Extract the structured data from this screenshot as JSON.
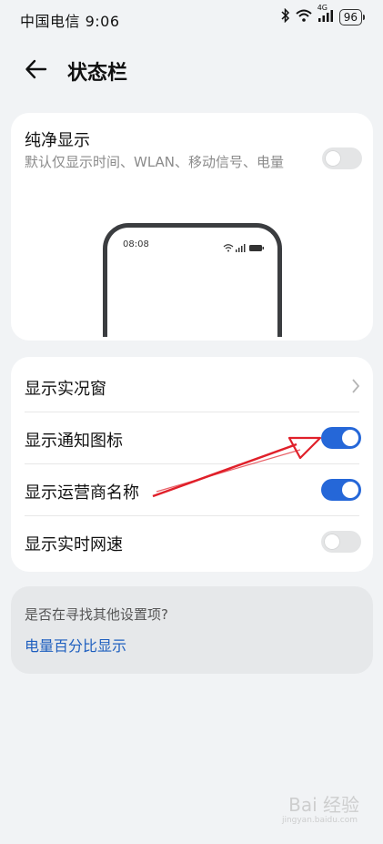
{
  "status_bar": {
    "carrier_time": "中国电信 9:06",
    "network_label": "4G",
    "battery": "96",
    "icons": [
      "bluetooth-icon",
      "wifi-icon",
      "signal-icon",
      "battery-icon"
    ]
  },
  "header": {
    "title": "状态栏",
    "back_icon": "arrow-left-icon"
  },
  "pure_display": {
    "title": "纯净显示",
    "description": "默认仅显示时间、WLAN、移动信号、电量",
    "enabled": false,
    "preview_time": "08:08"
  },
  "settings": [
    {
      "label": "显示实况窗",
      "type": "link",
      "icon": "chevron-right-icon"
    },
    {
      "label": "显示通知图标",
      "type": "toggle",
      "enabled": true
    },
    {
      "label": "显示运营商名称",
      "type": "toggle",
      "enabled": true
    },
    {
      "label": "显示实时网速",
      "type": "toggle",
      "enabled": false
    }
  ],
  "suggestion": {
    "question": "是否在寻找其他设置项?",
    "link": "电量百分比显示"
  },
  "watermark": {
    "text": "Bai 经验",
    "sub": "jingyan.baidu.com"
  },
  "colors": {
    "accent": "#2567d8",
    "annotation_arrow": "#e0202a"
  }
}
